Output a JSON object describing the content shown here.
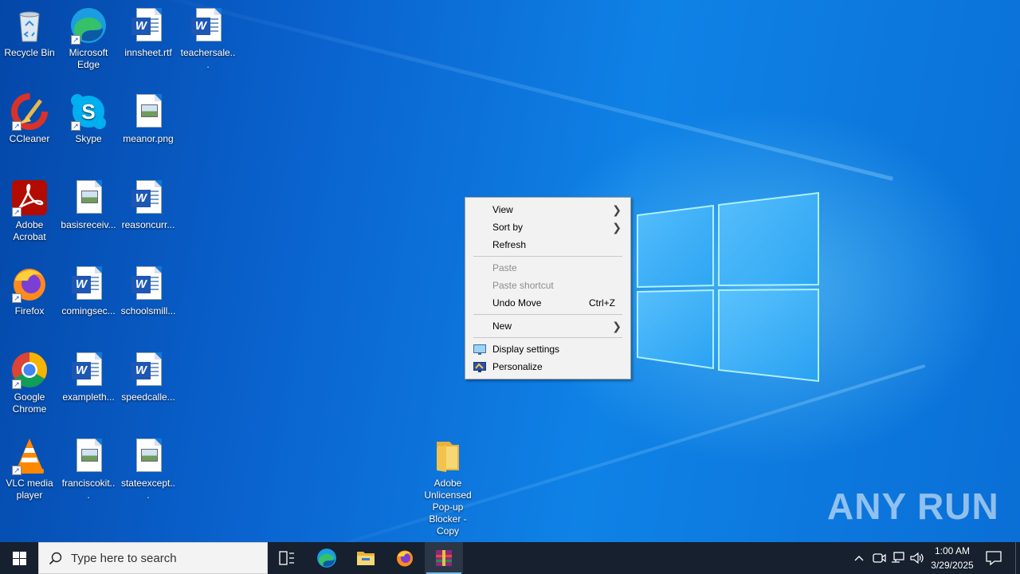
{
  "desktop": {
    "icons": [
      {
        "label": "Recycle Bin",
        "icon": "recycle-bin-icon"
      },
      {
        "label": "Microsoft Edge",
        "icon": "edge-icon"
      },
      {
        "label": "innsheet.rtf",
        "icon": "word-doc-icon"
      },
      {
        "label": "teachersale...",
        "icon": "word-doc-icon"
      },
      {
        "label": "CCleaner",
        "icon": "ccleaner-icon"
      },
      {
        "label": "Skype",
        "icon": "skype-icon"
      },
      {
        "label": "meanor.png",
        "icon": "image-file-icon"
      },
      {
        "label": "Adobe Acrobat",
        "icon": "acrobat-icon"
      },
      {
        "label": "basisreceiv...",
        "icon": "image-file-icon"
      },
      {
        "label": "reasoncurr...",
        "icon": "word-doc-icon"
      },
      {
        "label": "Firefox",
        "icon": "firefox-icon"
      },
      {
        "label": "comingsec...",
        "icon": "word-doc-icon"
      },
      {
        "label": "schoolsmill...",
        "icon": "word-doc-icon"
      },
      {
        "label": "Google Chrome",
        "icon": "chrome-icon"
      },
      {
        "label": "exampleth...",
        "icon": "word-doc-icon"
      },
      {
        "label": "speedcalle...",
        "icon": "word-doc-icon"
      },
      {
        "label": "VLC media player",
        "icon": "vlc-icon"
      },
      {
        "label": "franciscokit...",
        "icon": "image-file-icon"
      },
      {
        "label": "stateexcept...",
        "icon": "image-file-icon"
      },
      {
        "label": "Adobe Unlicensed Pop-up Blocker - Copy",
        "icon": "folder-icon"
      }
    ]
  },
  "context_menu": {
    "view": "View",
    "sort_by": "Sort by",
    "refresh": "Refresh",
    "paste": "Paste",
    "paste_shortcut": "Paste shortcut",
    "undo_move": "Undo Move",
    "undo_shortcut": "Ctrl+Z",
    "new": "New",
    "display_settings": "Display settings",
    "personalize": "Personalize"
  },
  "taskbar": {
    "search_placeholder": "Type here to search",
    "apps": [
      "task-view-icon",
      "edge-icon",
      "file-explorer-icon",
      "firefox-icon",
      "winrar-icon"
    ],
    "clock_time": "1:00 AM",
    "clock_date": "3/29/2025"
  },
  "watermark": "ANY RUN",
  "colors": {
    "desktop_blue": "#0a6fd6",
    "taskbar": "#16202e",
    "menu_bg": "#f2f2f2",
    "active_indicator": "#76b9ed"
  }
}
